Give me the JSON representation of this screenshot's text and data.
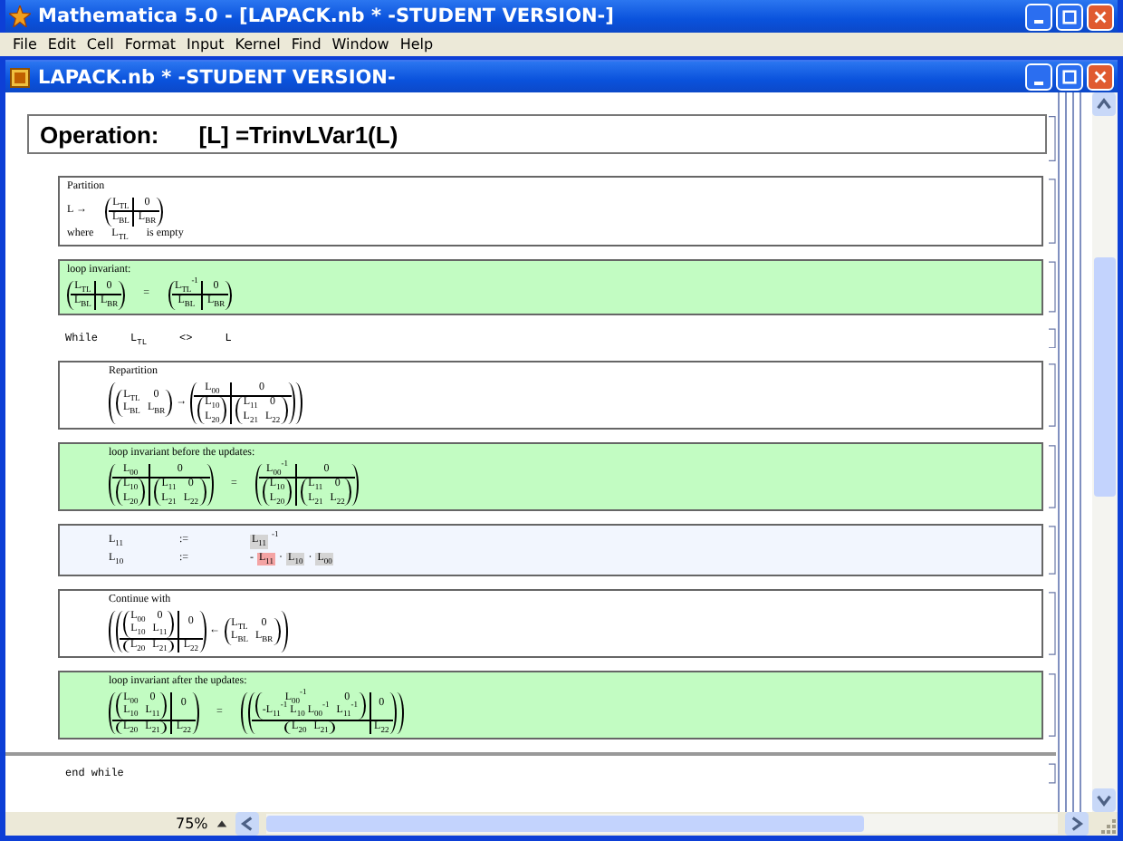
{
  "window": {
    "title": "Mathematica 5.0 - [LAPACK.nb *  -STUDENT VERSION-]"
  },
  "menu": [
    "File",
    "Edit",
    "Cell",
    "Format",
    "Input",
    "Kernel",
    "Find",
    "Window",
    "Help"
  ],
  "notebook": {
    "title": "LAPACK.nb *  -STUDENT VERSION-",
    "heading": {
      "label": "Operation:",
      "formula": "[L] =TrinvLVar1(L)"
    },
    "cells": [
      {
        "kind": "box",
        "color": "#ffffff",
        "indented": false,
        "lines": [
          [
            "Partition"
          ],
          [
            "L →",
            {
              "partitioned": true,
              "rows": [
                [
                  "L$_{TL}$",
                  "0"
                ],
                [
                  "L$_{BL}$",
                  "L$_{BR}$"
                ]
              ]
            }
          ],
          [
            "where",
            "L$_{TL}$",
            "is empty"
          ]
        ]
      },
      {
        "kind": "box",
        "color": "#c2fcc2",
        "indented": false,
        "lines": [
          [
            "loop invariant:"
          ],
          [
            {
              "partitioned": true,
              "rows": [
                [
                  "L$_{TL}$",
                  "0"
                ],
                [
                  "L$_{BL}$",
                  "L$_{BR}$"
                ]
              ]
            },
            "=",
            {
              "partitioned": true,
              "rows": [
                [
                  "L$_{TL}$$^{-1}$",
                  "0"
                ],
                [
                  "L$_{BL}$",
                  "L$_{BR}$"
                ]
              ]
            }
          ]
        ]
      },
      {
        "kind": "line",
        "parts": [
          "While",
          "L$_{TL}$",
          "<>",
          "L"
        ]
      },
      {
        "kind": "box",
        "color": "#ffffff",
        "indented": true,
        "lines": [
          [
            "Repartition"
          ],
          [
            {
              "rows": [
                [
                  [
                    {
                      "rows": [
                        [
                          "L$_{TL}$",
                          "0"
                        ],
                        [
                          "L$_{BL}$",
                          "L$_{BR}$"
                        ]
                      ]
                    },
                    "→",
                    {
                      "partitioned": true,
                      "rows": [
                        [
                          "L$_{00}$",
                          "0"
                        ],
                        [
                          {
                            "rows": [
                              [
                                "L$_{10}$"
                              ],
                              [
                                "L$_{20}$"
                              ]
                            ]
                          },
                          {
                            "rows": [
                              [
                                "L$_{11}$",
                                "0"
                              ],
                              [
                                "L$_{21}$",
                                "L$_{22}$"
                              ]
                            ]
                          }
                        ]
                      ]
                    }
                  ]
                ]
              ]
            }
          ]
        ]
      },
      {
        "kind": "box",
        "color": "#c2fcc2",
        "indented": true,
        "lines": [
          [
            "loop invariant before the updates:"
          ],
          [
            {
              "partitioned": true,
              "rows": [
                [
                  "L$_{00}$",
                  "0"
                ],
                [
                  {
                    "rows": [
                      [
                        "L$_{10}$"
                      ],
                      [
                        "L$_{20}$"
                      ]
                    ]
                  },
                  {
                    "rows": [
                      [
                        "L$_{11}$",
                        "0"
                      ],
                      [
                        "L$_{21}$",
                        "L$_{22}$"
                      ]
                    ]
                  }
                ]
              ]
            },
            "=",
            {
              "partitioned": true,
              "rows": [
                [
                  "L$_{00}$$^{-1}$",
                  "0"
                ],
                [
                  {
                    "rows": [
                      [
                        "L$_{10}$"
                      ],
                      [
                        "L$_{20}$"
                      ]
                    ]
                  },
                  {
                    "rows": [
                      [
                        "L$_{11}$",
                        "0"
                      ],
                      [
                        "L$_{21}$",
                        "L$_{22}$"
                      ]
                    ]
                  }
                ]
              ]
            }
          ]
        ]
      },
      {
        "kind": "assign",
        "color": "#f2f6fe",
        "rows": [
          {
            "target": "L$_{11}$",
            "op": ":=",
            "value": [
              {
                "text": "L$_{11}$",
                "color": "#d4d4d4"
              },
              "$^{-1}$"
            ]
          },
          {
            "target": "L$_{10}$",
            "op": ":=",
            "value": [
              "-",
              {
                "text": "L$_{11}$",
                "color": "#f4a4a4"
              },
              "·",
              {
                "text": "L$_{10}$",
                "color": "#d4d4d4"
              },
              "·",
              {
                "text": "L$_{00}$",
                "color": "#d4d4d4"
              }
            ]
          }
        ]
      },
      {
        "kind": "box",
        "color": "#ffffff",
        "indented": true,
        "lines": [
          [
            "Continue with"
          ],
          [
            {
              "rows": [
                [
                  [
                    {
                      "partitioned": true,
                      "rows": [
                        [
                          {
                            "rows": [
                              [
                                "L$_{00}$",
                                "0"
                              ],
                              [
                                "L$_{10}$",
                                "L$_{11}$"
                              ]
                            ]
                          },
                          "0"
                        ],
                        [
                          {
                            "rows": [
                              [
                                "L$_{20}$",
                                "L$_{21}$"
                              ]
                            ]
                          },
                          "L$_{22}$"
                        ]
                      ]
                    },
                    "←",
                    {
                      "rows": [
                        [
                          "L$_{TL}$",
                          "0"
                        ],
                        [
                          "L$_{BL}$",
                          "L$_{BR}$"
                        ]
                      ]
                    }
                  ]
                ]
              ]
            }
          ]
        ]
      },
      {
        "kind": "box",
        "color": "#c2fcc2",
        "indented": true,
        "lines": [
          [
            "loop invariant after the updates:"
          ],
          [
            {
              "partitioned": true,
              "rows": [
                [
                  {
                    "rows": [
                      [
                        "L$_{00}$",
                        "0"
                      ],
                      [
                        "L$_{10}$",
                        "L$_{11}$"
                      ]
                    ]
                  },
                  "0"
                ],
                [
                  {
                    "rows": [
                      [
                        "L$_{20}$",
                        "L$_{21}$"
                      ]
                    ]
                  },
                  "L$_{22}$"
                ]
              ]
            },
            "=",
            {
              "rows": [
                [
                  {
                    "partitioned": true,
                    "rows": [
                      [
                        {
                          "rows": [
                            [
                              "L$_{00}$$^{-1}$",
                              "0"
                            ],
                            [
                              "-L$_{11}$$^{-1}$ L$_{10}$ L$_{00}$$^{-1}$",
                              "L$_{11}$$^{-1}$"
                            ]
                          ]
                        },
                        "0"
                      ],
                      [
                        {
                          "rows": [
                            [
                              "L$_{20}$",
                              "L$_{21}$"
                            ]
                          ]
                        },
                        "L$_{22}$"
                      ]
                    ]
                  }
                ]
              ]
            }
          ]
        ]
      },
      {
        "kind": "rule"
      },
      {
        "kind": "line",
        "parts": [
          "end while"
        ]
      }
    ]
  },
  "status_bar": {
    "zoom": "75%"
  }
}
